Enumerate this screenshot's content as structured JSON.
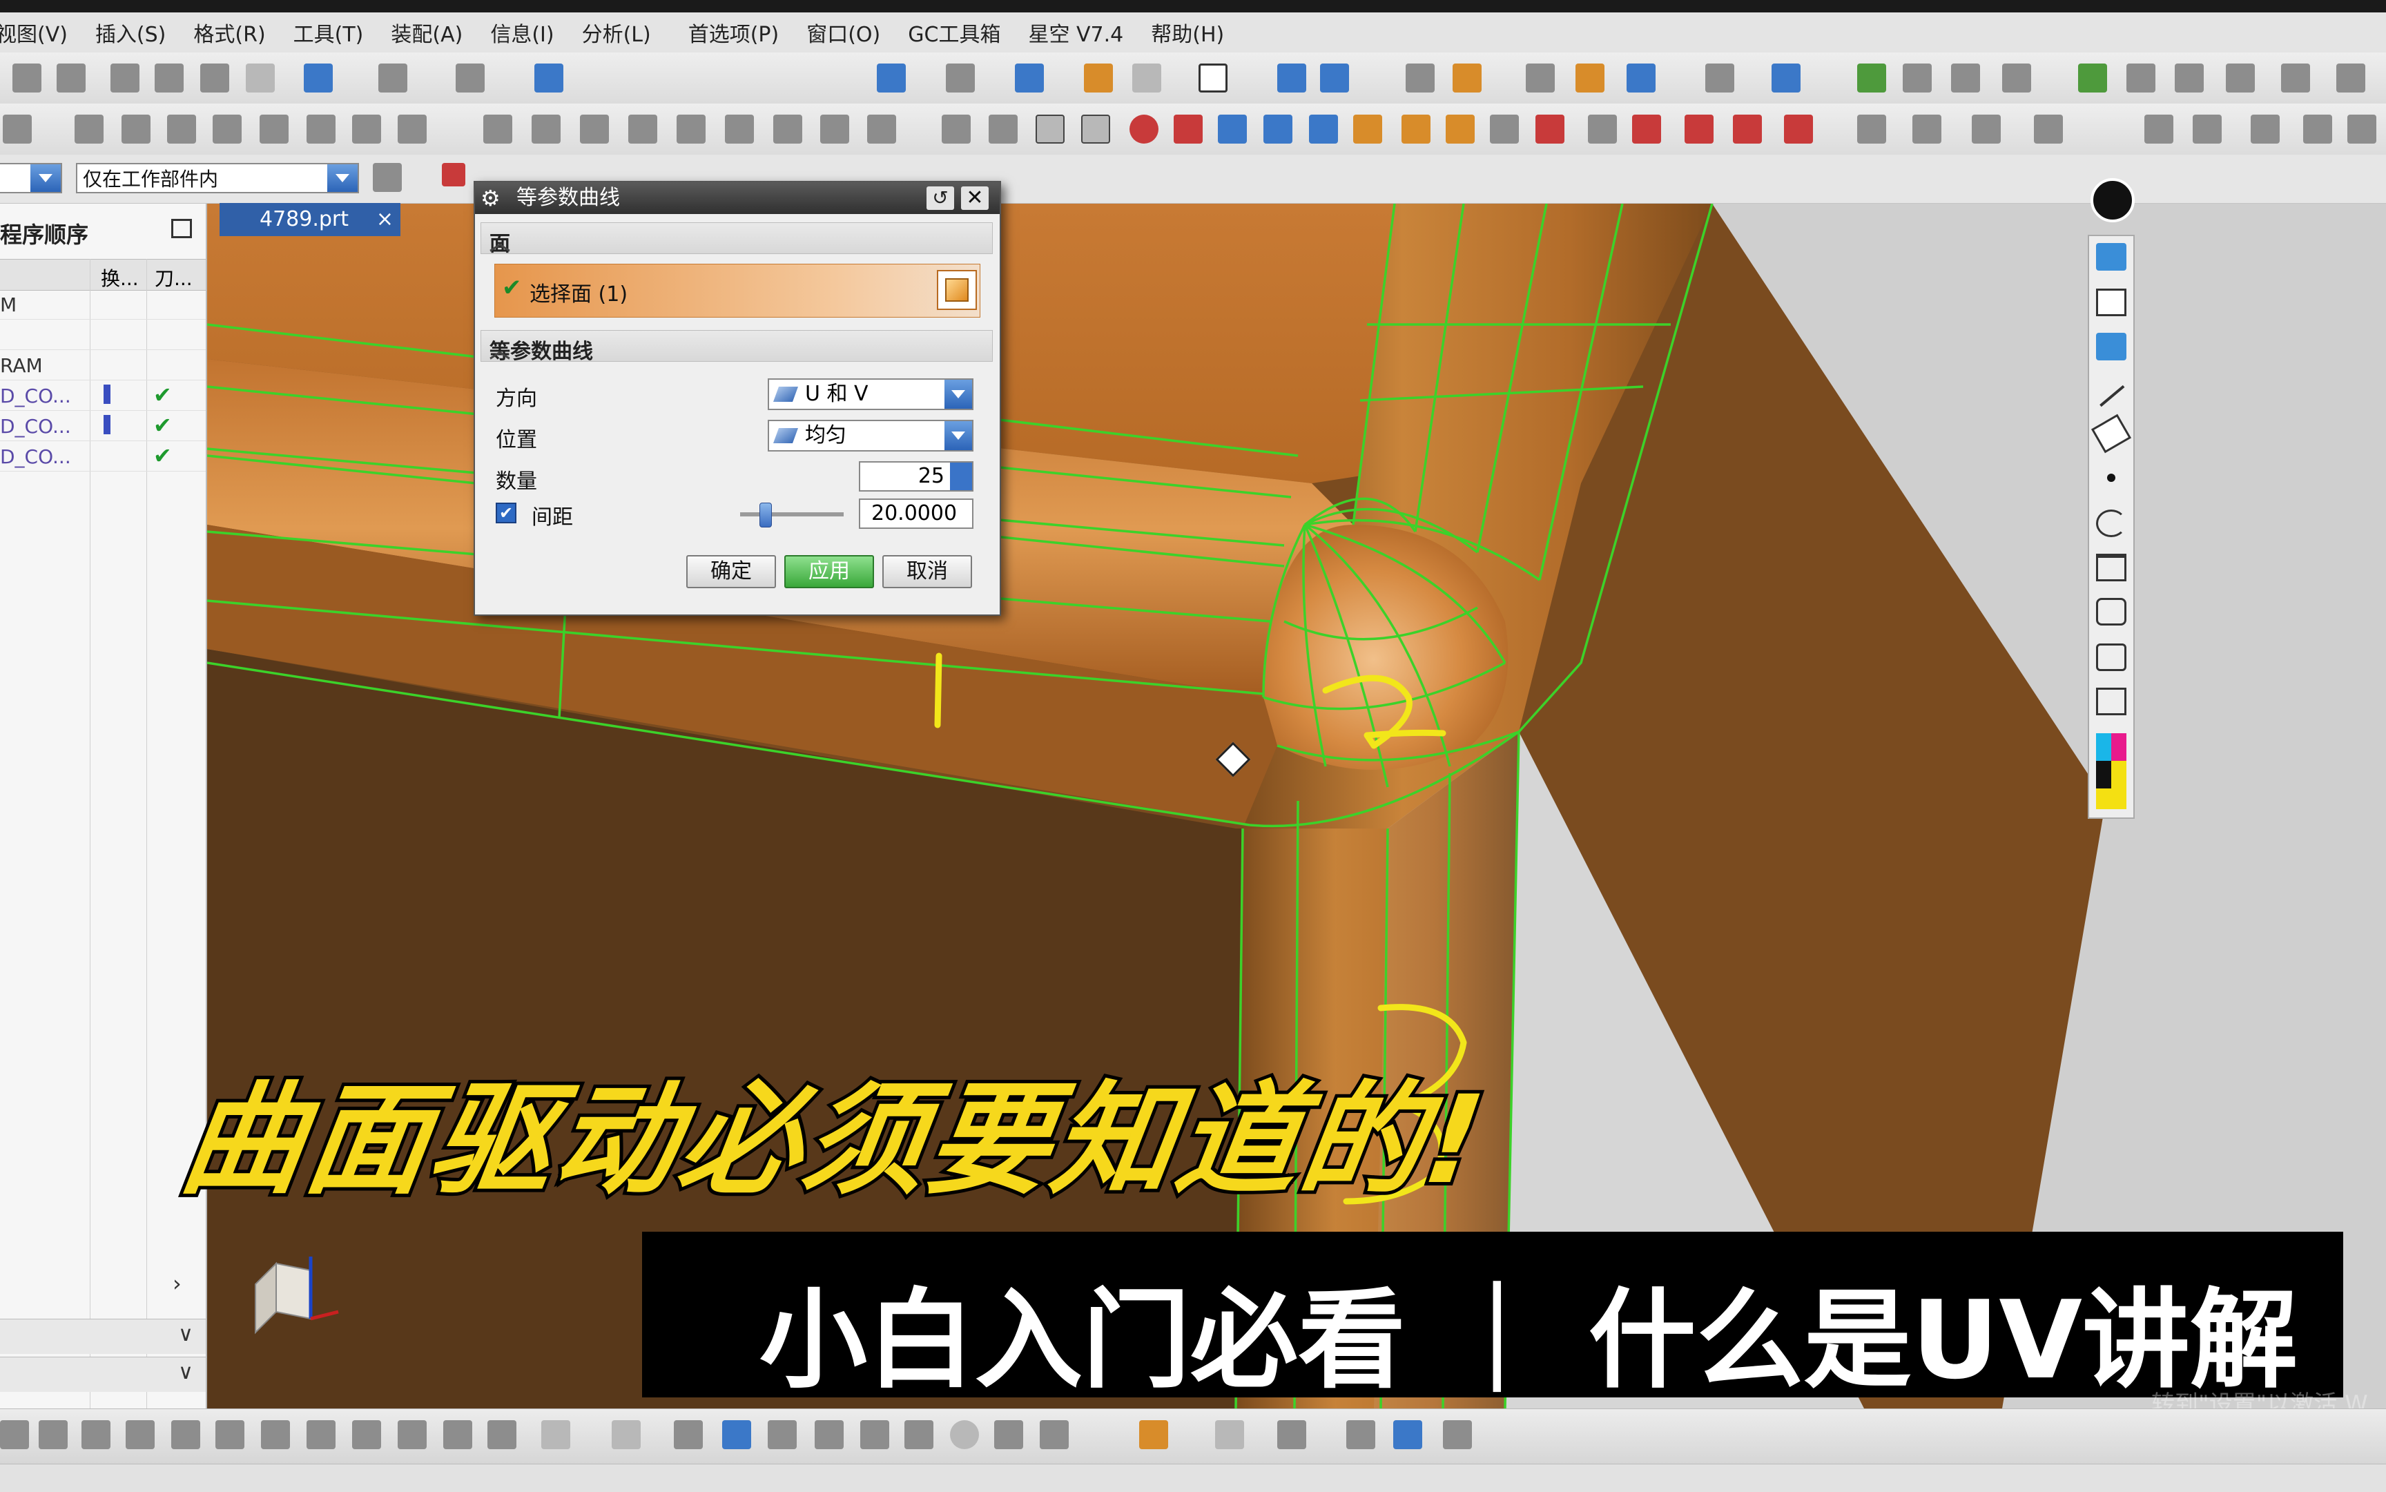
{
  "menubar": {
    "items": [
      "视图(V)",
      "插入(S)",
      "格式(R)",
      "工具(T)",
      "装配(A)",
      "信息(I)",
      "分析(L)",
      "首选项(P)",
      "窗口(O)",
      "GC工具箱",
      "星空 V7.4",
      "帮助(H)"
    ]
  },
  "filterbar": {
    "scope_value": "仅在工作部件内"
  },
  "navigator": {
    "title": "程序顺序",
    "columns": [
      "换...",
      "刀..."
    ],
    "rows": [
      {
        "name": "M",
        "checked": ""
      },
      {
        "name": "",
        "checked": ""
      },
      {
        "name": "RAM",
        "checked": ""
      },
      {
        "name": "D_CO...",
        "checked": "✔"
      },
      {
        "name": "D_CO...",
        "checked": "✔"
      },
      {
        "name": "D_CO...",
        "checked": "✔"
      }
    ]
  },
  "doc_tab": {
    "label": "4789.prt",
    "close": "×"
  },
  "dialog": {
    "title": "等参数曲线",
    "reset_symbol": "↺",
    "close_symbol": "✕",
    "group_face": "面",
    "select_face_label": "选择面 (1)",
    "group_curves": "等参数曲线",
    "direction_label": "方向",
    "direction_value": "U 和 V",
    "position_label": "位置",
    "position_value": "均匀",
    "count_label": "数量",
    "count_value": "25",
    "spacing_label": "间距",
    "spacing_value": "20.0000",
    "spacing_checked": "✔",
    "ok_label": "确定",
    "apply_label": "应用",
    "cancel_label": "取消"
  },
  "annotations": {
    "label_1": "1",
    "label_2": "2",
    "label_3": "3"
  },
  "captions": {
    "title": "曲面驱动必须要知道的!",
    "subtitle": "小白入门必看 ｜ 什么是UV讲解"
  },
  "watermark": {
    "line1": "转到\"设置\"以激活 W"
  },
  "colors": {
    "part_orange": "#c97a2e",
    "part_shadow": "#5a3716",
    "iso_curve_green": "#3cd22a",
    "caption_yellow": "#f6d81c",
    "sketch_yellow": "#f2e61a",
    "dialog_title": "#3a3a3a",
    "apply_green": "#3aa83a"
  }
}
